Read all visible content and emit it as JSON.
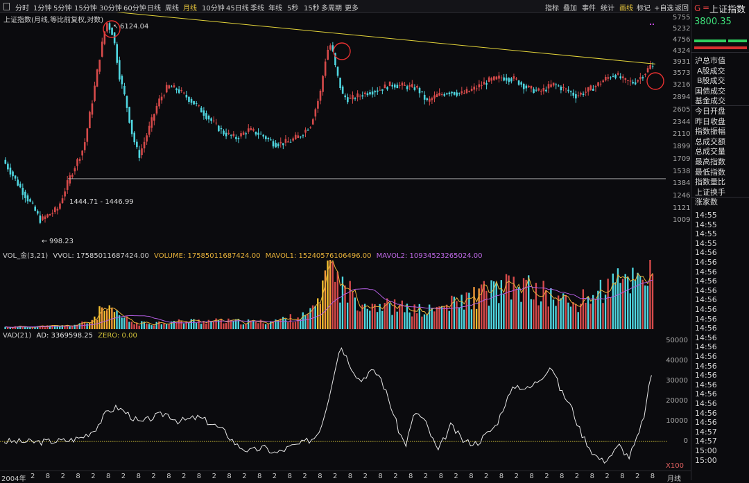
{
  "toolbar": {
    "timeframes": [
      "分时",
      "1分钟",
      "5分钟",
      "15分钟",
      "30分钟",
      "60分钟",
      "日线",
      "周线",
      "月线",
      "10分钟",
      "45日线",
      "季线",
      "年线",
      "5秒",
      "15秒",
      "多周期",
      "更多"
    ],
    "active_timeframe": "月线",
    "right_buttons": [
      "指标",
      "叠加",
      "事件",
      "统计",
      "画线",
      "标记",
      "+自选",
      "返回"
    ],
    "highlighted_button": "画线"
  },
  "main_chart": {
    "caption": "上证指数(月线,等比前复权,对数)",
    "peak_label": "6124.04",
    "low_label": "998.23",
    "range_label": "1444.71 - 1446.99",
    "y_ticks": [
      "5755",
      "5232",
      "4756",
      "4324",
      "3931",
      "3573",
      "3216",
      "2894",
      "2605",
      "2344",
      "2110",
      "1899",
      "1709",
      "1538",
      "1384",
      "1246",
      "1121",
      "1009"
    ]
  },
  "volume_pane": {
    "name": "VOL_金(3,21)",
    "vvol": "VVOL: 17585011687424.00",
    "volume": "VOLUME: 17585011687424.00",
    "mavol1": "MAVOL1: 15240576106496.00",
    "mavol2": "MAVOL2: 10934523265024.00"
  },
  "vad_pane": {
    "name": "VAD(21)",
    "ad": "AD: 3369598.25",
    "zero": "ZERO: 0.00",
    "y_ticks": [
      "50000",
      "40000",
      "30000",
      "20000",
      "10000",
      "0"
    ],
    "unit": "X100"
  },
  "x_axis": {
    "labels": [
      "2004年",
      "2",
      "8",
      "2",
      "8",
      "2",
      "8",
      "2",
      "8",
      "2",
      "8",
      "2",
      "8",
      "2",
      "8",
      "2",
      "8",
      "2",
      "8",
      "2",
      "8",
      "2",
      "8",
      "2",
      "8",
      "2",
      "8",
      "2",
      "8",
      "2",
      "8",
      "2",
      "8",
      "2",
      "8",
      "2",
      "8",
      "2",
      "8",
      "2",
      "8",
      "2",
      "8"
    ],
    "period": "月线"
  },
  "right_panel": {
    "logo": "G",
    "minus": "=",
    "title": "上证指数",
    "price": "3800.35",
    "items": [
      "沪总市值",
      "A股成交",
      "B股成交",
      "国债成交",
      "基金成交",
      "今日开盘",
      "昨日收盘",
      "指数振幅",
      "总成交额",
      "总成交量",
      "最高指数",
      "最低指数",
      "指数量比",
      "上证换手",
      "涨家数"
    ],
    "times": [
      "14:55",
      "14:55",
      "14:55",
      "14:55",
      "14:56",
      "14:56",
      "14:56",
      "14:56",
      "14:56",
      "14:56",
      "14:56",
      "14:56",
      "14:56",
      "14:56",
      "14:56",
      "14:56",
      "14:56",
      "14:56",
      "14:56",
      "14:56",
      "14:56",
      "14:56",
      "14:56",
      "14:57",
      "14:57",
      "15:00",
      "15:00"
    ]
  },
  "colors": {
    "up": "#d64a4a",
    "down": "#4fd6e0",
    "trendline": "#e3d43a",
    "circle": "#e53030",
    "mavol1": "#e8b23a",
    "mavol2": "#b25de0",
    "ad_line": "#e8e8e8",
    "zero_line": "#d6c63a",
    "price": "#3ee07a"
  }
}
